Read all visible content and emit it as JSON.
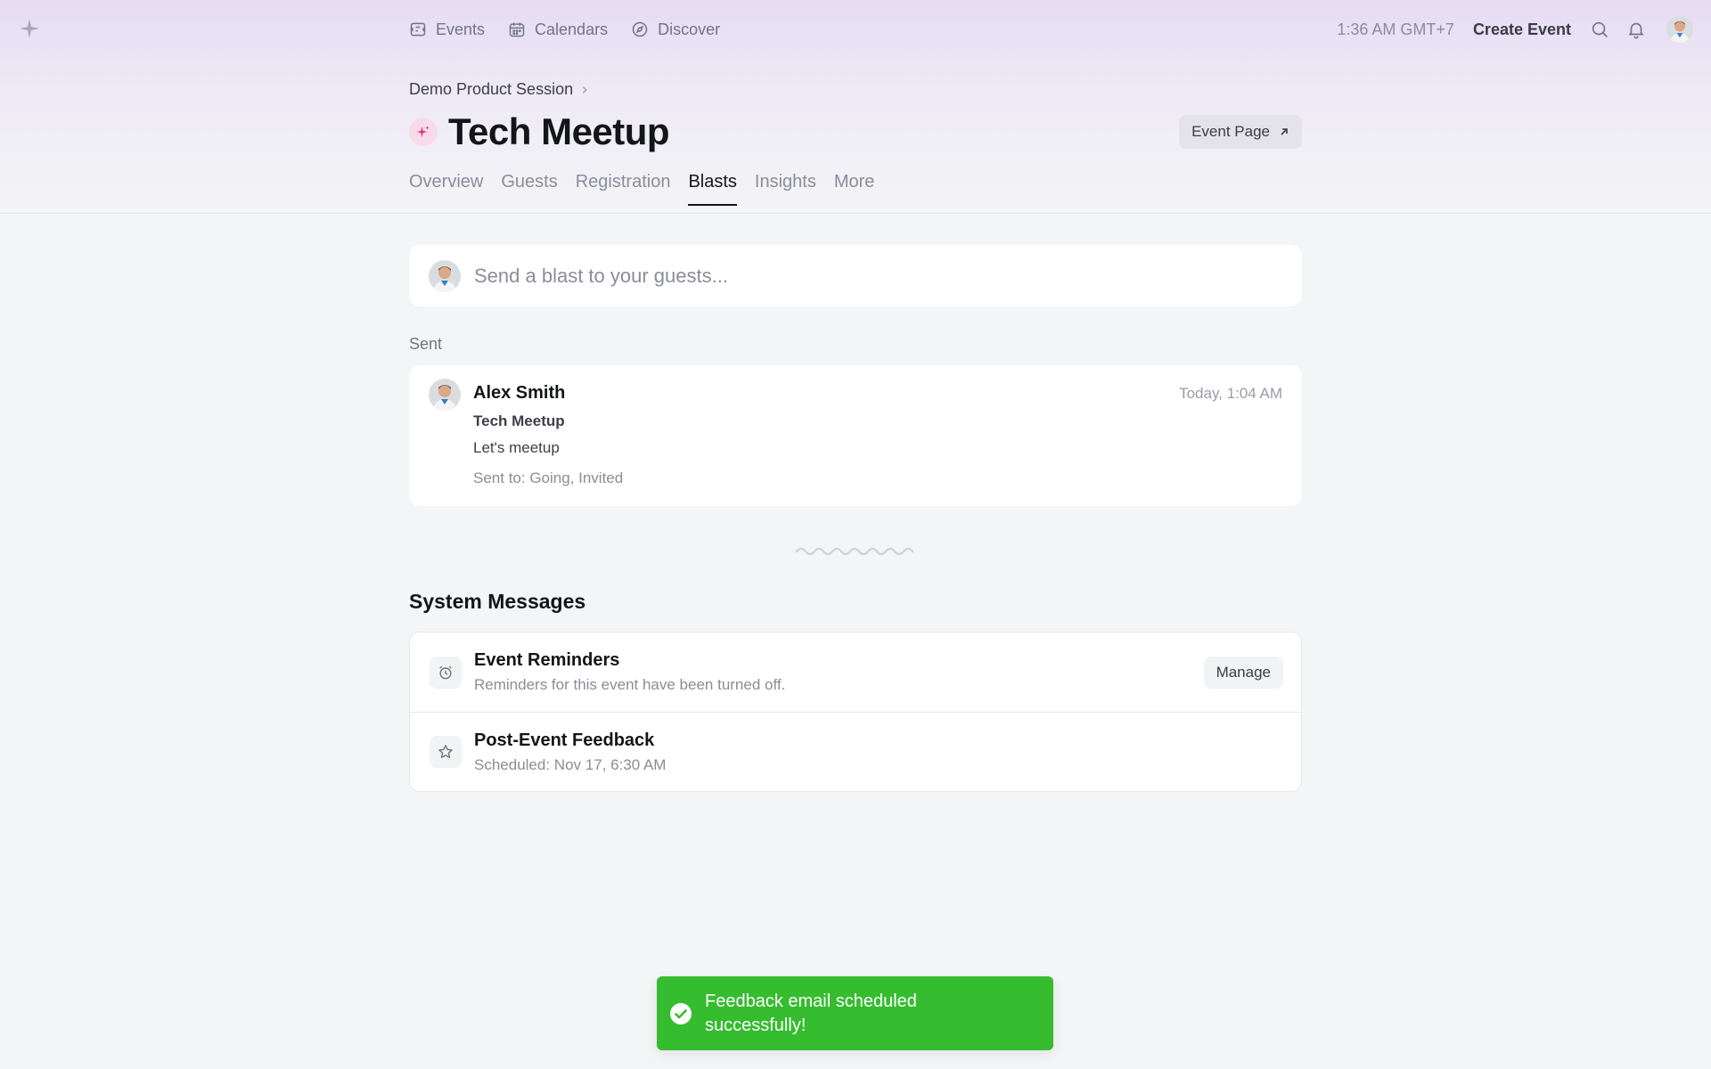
{
  "nav": {
    "items": [
      {
        "label": "Events",
        "icon": "ticket-icon"
      },
      {
        "label": "Calendars",
        "icon": "calendar-icon"
      },
      {
        "label": "Discover",
        "icon": "compass-icon"
      }
    ],
    "time": "1:36 AM GMT+7",
    "create_event": "Create Event"
  },
  "header": {
    "breadcrumb": "Demo Product Session",
    "title": "Tech Meetup",
    "event_page_button": "Event Page",
    "tabs": [
      "Overview",
      "Guests",
      "Registration",
      "Blasts",
      "Insights",
      "More"
    ],
    "active_tab": "Blasts"
  },
  "composer": {
    "placeholder": "Send a blast to your guests..."
  },
  "sent": {
    "label": "Sent",
    "blast": {
      "sender": "Alex Smith",
      "time": "Today, 1:04 AM",
      "subject": "Tech Meetup",
      "message": "Let's meetup",
      "recipients": "Sent to: Going, Invited"
    }
  },
  "system": {
    "title": "System Messages",
    "items": [
      {
        "name": "Event Reminders",
        "desc": "Reminders for this event have been turned off.",
        "icon": "alarm-clock-icon",
        "action": "Manage"
      },
      {
        "name": "Post-Event Feedback",
        "desc": "Scheduled: Nov 17, 6:30 AM",
        "icon": "star-icon"
      }
    ]
  },
  "toast": {
    "message": "Feedback email scheduled successfully!",
    "color": "#35bc2f"
  },
  "colors": {
    "accent_pink": "#e0307a",
    "text_primary": "#131517",
    "text_muted": "#8b8d97"
  }
}
